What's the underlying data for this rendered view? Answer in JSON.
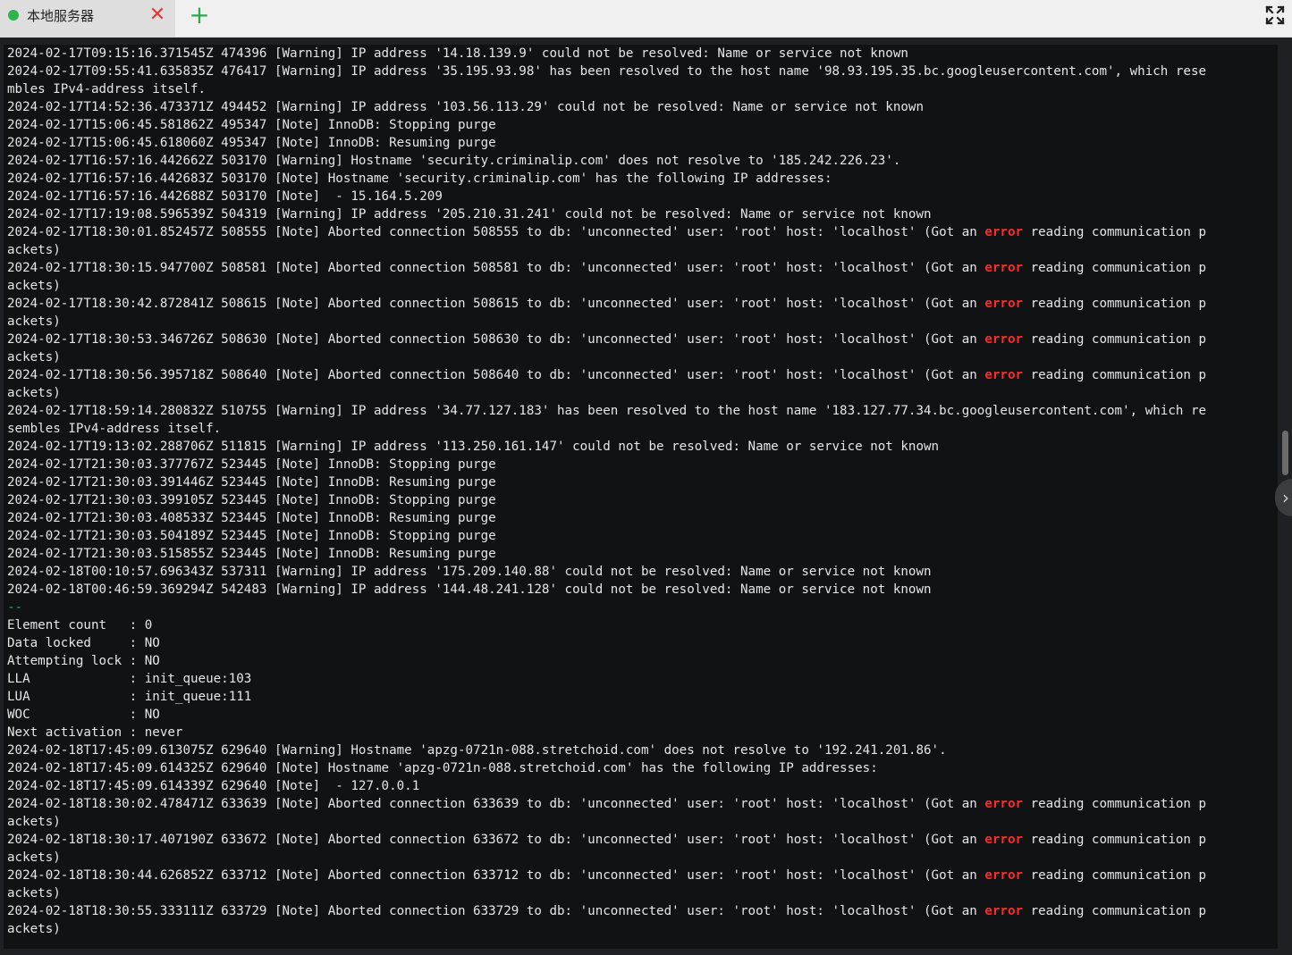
{
  "tab": {
    "title": "本地服务器",
    "status_color": "#2fb34a",
    "close_icon": "✕",
    "add_icon": "+"
  },
  "window": {
    "fullscreen_icon": "expand-icon"
  },
  "terminal": {
    "side_toggle_icon": "›",
    "lines": [
      {
        "text": "2024-02-17T09:15:16.371545Z 474396 [Warning] IP address '14.18.139.9' could not be resolved: Name or service not known"
      },
      {
        "text": "2024-02-17T09:55:41.635835Z 476417 [Warning] IP address '35.195.93.98' has been resolved to the host name '98.93.195.35.bc.googleusercontent.com', which rese"
      },
      {
        "text": "mbles IPv4-address itself."
      },
      {
        "text": "2024-02-17T14:52:36.473371Z 494452 [Warning] IP address '103.56.113.29' could not be resolved: Name or service not known"
      },
      {
        "text": "2024-02-17T15:06:45.581862Z 495347 [Note] InnoDB: Stopping purge"
      },
      {
        "text": "2024-02-17T15:06:45.618060Z 495347 [Note] InnoDB: Resuming purge"
      },
      {
        "text": "2024-02-17T16:57:16.442662Z 503170 [Warning] Hostname 'security.criminalip.com' does not resolve to '185.242.226.23'."
      },
      {
        "text": "2024-02-17T16:57:16.442683Z 503170 [Note] Hostname 'security.criminalip.com' has the following IP addresses:"
      },
      {
        "text": "2024-02-17T16:57:16.442688Z 503170 [Note]  - 15.164.5.209"
      },
      {
        "text": "2024-02-17T17:19:08.596539Z 504319 [Warning] IP address '205.210.31.241' could not be resolved: Name or service not known"
      },
      {
        "pre": "2024-02-17T18:30:01.852457Z 508555 [Note] Aborted connection 508555 to db: 'unconnected' user: 'root' host: 'localhost' (Got an ",
        "err": "error",
        "post": " reading communication p"
      },
      {
        "text": "ackets)"
      },
      {
        "pre": "2024-02-17T18:30:15.947700Z 508581 [Note] Aborted connection 508581 to db: 'unconnected' user: 'root' host: 'localhost' (Got an ",
        "err": "error",
        "post": " reading communication p"
      },
      {
        "text": "ackets)"
      },
      {
        "pre": "2024-02-17T18:30:42.872841Z 508615 [Note] Aborted connection 508615 to db: 'unconnected' user: 'root' host: 'localhost' (Got an ",
        "err": "error",
        "post": " reading communication p"
      },
      {
        "text": "ackets)"
      },
      {
        "pre": "2024-02-17T18:30:53.346726Z 508630 [Note] Aborted connection 508630 to db: 'unconnected' user: 'root' host: 'localhost' (Got an ",
        "err": "error",
        "post": " reading communication p"
      },
      {
        "text": "ackets)"
      },
      {
        "pre": "2024-02-17T18:30:56.395718Z 508640 [Note] Aborted connection 508640 to db: 'unconnected' user: 'root' host: 'localhost' (Got an ",
        "err": "error",
        "post": " reading communication p"
      },
      {
        "text": "ackets)"
      },
      {
        "text": "2024-02-17T18:59:14.280832Z 510755 [Warning] IP address '34.77.127.183' has been resolved to the host name '183.127.77.34.bc.googleusercontent.com', which re"
      },
      {
        "text": "sembles IPv4-address itself."
      },
      {
        "text": "2024-02-17T19:13:02.288706Z 511815 [Warning] IP address '113.250.161.147' could not be resolved: Name or service not known"
      },
      {
        "text": "2024-02-17T21:30:03.377767Z 523445 [Note] InnoDB: Stopping purge"
      },
      {
        "text": "2024-02-17T21:30:03.391446Z 523445 [Note] InnoDB: Resuming purge"
      },
      {
        "text": "2024-02-17T21:30:03.399105Z 523445 [Note] InnoDB: Stopping purge"
      },
      {
        "text": "2024-02-17T21:30:03.408533Z 523445 [Note] InnoDB: Resuming purge"
      },
      {
        "text": "2024-02-17T21:30:03.504189Z 523445 [Note] InnoDB: Stopping purge"
      },
      {
        "text": "2024-02-17T21:30:03.515855Z 523445 [Note] InnoDB: Resuming purge"
      },
      {
        "text": "2024-02-18T00:10:57.696343Z 537311 [Warning] IP address '175.209.140.88' could not be resolved: Name or service not known"
      },
      {
        "text": "2024-02-18T00:46:59.369294Z 542483 [Warning] IP address '144.48.241.128' could not be resolved: Name or service not known"
      },
      {
        "sep": "--"
      },
      {
        "text": "Element count   : 0"
      },
      {
        "text": "Data locked     : NO"
      },
      {
        "text": "Attempting lock : NO"
      },
      {
        "text": "LLA             : init_queue:103"
      },
      {
        "text": "LUA             : init_queue:111"
      },
      {
        "text": "WOC             : NO"
      },
      {
        "text": "Next activation : never"
      },
      {
        "text": "2024-02-18T17:45:09.613075Z 629640 [Warning] Hostname 'apzg-0721n-088.stretchoid.com' does not resolve to '192.241.201.86'."
      },
      {
        "text": "2024-02-18T17:45:09.614325Z 629640 [Note] Hostname 'apzg-0721n-088.stretchoid.com' has the following IP addresses:"
      },
      {
        "text": "2024-02-18T17:45:09.614339Z 629640 [Note]  - 127.0.0.1"
      },
      {
        "pre": "2024-02-18T18:30:02.478471Z 633639 [Note] Aborted connection 633639 to db: 'unconnected' user: 'root' host: 'localhost' (Got an ",
        "err": "error",
        "post": " reading communication p"
      },
      {
        "text": "ackets)"
      },
      {
        "pre": "2024-02-18T18:30:17.407190Z 633672 [Note] Aborted connection 633672 to db: 'unconnected' user: 'root' host: 'localhost' (Got an ",
        "err": "error",
        "post": " reading communication p"
      },
      {
        "text": "ackets)"
      },
      {
        "pre": "2024-02-18T18:30:44.626852Z 633712 [Note] Aborted connection 633712 to db: 'unconnected' user: 'root' host: 'localhost' (Got an ",
        "err": "error",
        "post": " reading communication p"
      },
      {
        "text": "ackets)"
      },
      {
        "pre": "2024-02-18T18:30:55.333111Z 633729 [Note] Aborted connection 633729 to db: 'unconnected' user: 'root' host: 'localhost' (Got an ",
        "err": "error",
        "post": " reading communication p"
      },
      {
        "text": "ackets)"
      }
    ]
  },
  "colors": {
    "error_text": "#ff2b2b",
    "terminal_bg": "#111214",
    "terminal_fg": "#e6e6e6",
    "accent_green": "#2fa84f"
  }
}
